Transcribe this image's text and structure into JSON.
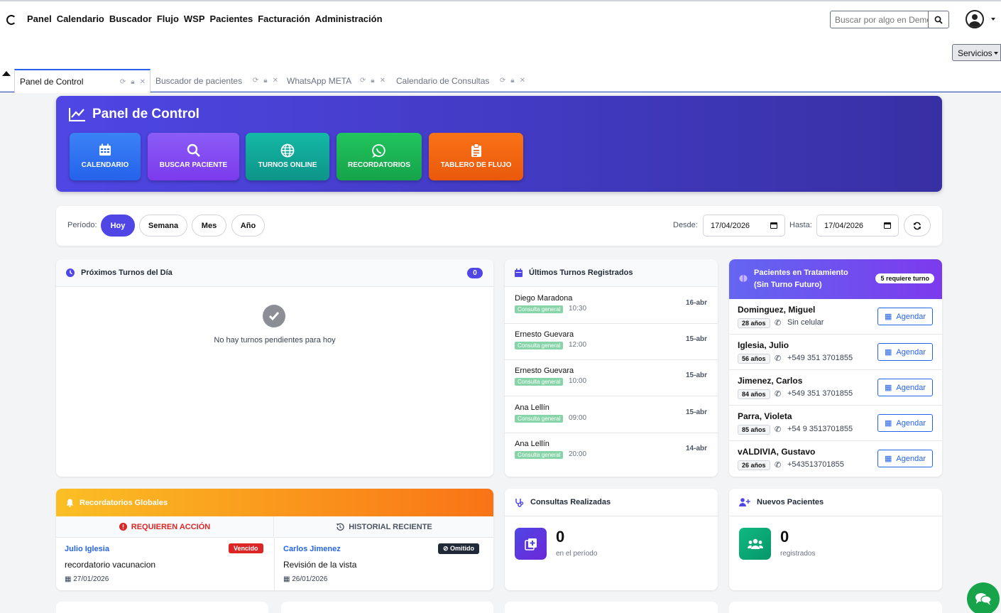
{
  "nav": {
    "links": [
      "Panel",
      "Calendario",
      "Buscador",
      "Flujo",
      "WSP",
      "Pacientes",
      "Facturación",
      "Administración"
    ],
    "search_placeholder": "Buscar por algo en Demo",
    "services_label": "Servicios"
  },
  "tabs": [
    {
      "label": "Panel de Control",
      "active": true
    },
    {
      "label": "Buscador de pacientes",
      "active": false
    },
    {
      "label": "WhatsApp META",
      "active": false
    },
    {
      "label": "Calendario de Consultas",
      "active": false
    }
  ],
  "hero": {
    "title": "Panel de Control",
    "buttons": [
      {
        "label": "CALENDARIO",
        "icon": "calendar-icon",
        "color": "#2563eb"
      },
      {
        "label": "BUSCAR PACIENTE",
        "icon": "search-icon",
        "color": "#7c3aed"
      },
      {
        "label": "TURNOS ONLINE",
        "icon": "globe-icon",
        "color": "#14b8a6"
      },
      {
        "label": "RECORDATORIOS",
        "icon": "whatsapp-icon",
        "color": "#22c55e"
      },
      {
        "label": "TABLERO DE FLUJO",
        "icon": "clipboard-icon",
        "color": "#f97316"
      }
    ]
  },
  "period": {
    "label": "Período:",
    "options": [
      "Hoy",
      "Semana",
      "Mes",
      "Año"
    ],
    "selected": "Hoy",
    "desde_label": "Desde:",
    "desde_value": "17/04/2026",
    "hasta_label": "Hasta:",
    "hasta_value": "17/04/2026"
  },
  "proximos": {
    "title": "Próximos Turnos del Día",
    "count": "0",
    "empty_text": "No hay turnos pendientes para hoy"
  },
  "ultimos": {
    "title": "Últimos Turnos Registrados",
    "items": [
      {
        "name": "Diego Maradona",
        "tag": "Consulta general",
        "time": "10:30",
        "date": "16-abr"
      },
      {
        "name": "Ernesto Guevara",
        "tag": "Consulta general",
        "time": "12:00",
        "date": "15-abr"
      },
      {
        "name": "Ernesto Guevara",
        "tag": "Consulta general",
        "time": "10:00",
        "date": "15-abr"
      },
      {
        "name": "Ana Lellín",
        "tag": "Consulta general",
        "time": "09:00",
        "date": "15-abr"
      },
      {
        "name": "Ana Lellín",
        "tag": "Consulta general",
        "time": "20:00",
        "date": "14-abr"
      }
    ]
  },
  "tratamiento": {
    "title_line1": "Pacientes en Tratamiento",
    "title_line2": "(Sin Turno Futuro)",
    "badge": "5 requiere turno",
    "agendar_label": "Agendar",
    "patients": [
      {
        "name": "Dominguez, Miguel",
        "age": "28 años",
        "phone": "Sin celular"
      },
      {
        "name": "Iglesia, Julio",
        "age": "56 años",
        "phone": "+549 351 3701855"
      },
      {
        "name": "Jimenez, Carlos",
        "age": "84 años",
        "phone": "+549 351 3701855"
      },
      {
        "name": "Parra, Violeta",
        "age": "85 años",
        "phone": "+54 9 3513701855"
      },
      {
        "name": "vALDIVIA, Gustavo",
        "age": "26 años",
        "phone": "+543513701855"
      }
    ]
  },
  "recordatorios": {
    "title": "Recordatorios Globales",
    "left_header": "REQUIEREN ACCIÓN",
    "right_header": "HISTORIAL RECIENTE",
    "left_item": {
      "name": "Julio Iglesia",
      "badge": "Vencido",
      "text": "recordatorio vacunacion",
      "date": "27/01/2026"
    },
    "right_item": {
      "name": "Carlos Jimenez",
      "badge": "Omitido",
      "text": "Revisión de la vista",
      "date": "26/01/2026"
    }
  },
  "consultas": {
    "title": "Consultas Realizadas",
    "value": "0",
    "sub": "en el período"
  },
  "nuevos": {
    "title": "Nuevos Pacientes",
    "value": "0",
    "sub": "registrados"
  }
}
